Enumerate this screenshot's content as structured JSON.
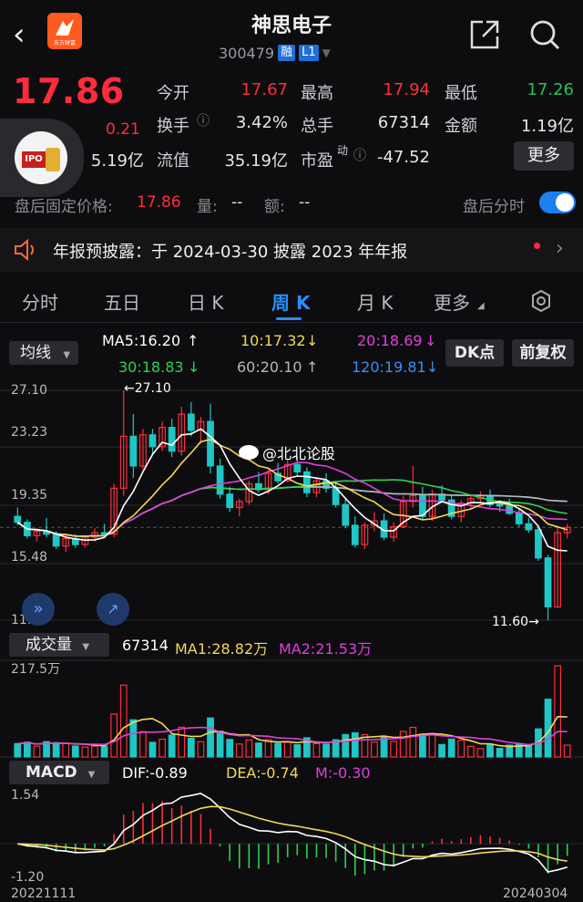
{
  "header": {
    "stock_name": "神思电子",
    "stock_code": "300479",
    "tag_margin": "融",
    "tag_level": "L1",
    "logo_brand": "东方财富"
  },
  "quote": {
    "price": "17.86",
    "change": "0.21",
    "rows": [
      {
        "l1": "今开",
        "v1": "17.67",
        "c1": "up",
        "l2": "最高",
        "v2": "17.94",
        "c2": "up",
        "l3": "最低",
        "v3": "17.26",
        "c3": "down"
      },
      {
        "l1": "换手",
        "v1": "3.42%",
        "c1": "white",
        "l2": "总手",
        "v2": "67314",
        "c2": "white",
        "l3": "金额",
        "v3": "1.19亿",
        "c3": "white"
      },
      {
        "l0v": "5.19亿",
        "l1": "流值",
        "v1": "35.19亿",
        "c1": "white",
        "l2": "市盈",
        "l2sup": "动",
        "v2": "-47.52",
        "c2": "white"
      }
    ],
    "more_label": "更多",
    "avatar_text": "IPO"
  },
  "after_hours": {
    "label": "盘后固定价格:",
    "price": "17.86",
    "vol_label": "量:",
    "vol": "--",
    "amt_label": "额:",
    "amt": "--",
    "toggle_label": "盘后分时"
  },
  "notice": {
    "text": "年报预披露：于 2024-03-30 披露 2023 年年报"
  },
  "tabs": [
    "分时",
    "五日",
    "日 K",
    "周 K",
    "月 K",
    "更多"
  ],
  "active_tab": "周 K",
  "toolbar": {
    "ma_select": "均线",
    "ma5": "MA5:16.20",
    "ma10": "10:17.32",
    "ma20": "20:18.69",
    "ma30": "30:18.83",
    "ma60": "60:20.10",
    "ma120": "120:19.81",
    "dk_label": "DK点",
    "fq_label": "前复权"
  },
  "kline": {
    "y_labels": [
      "27.10",
      "23.23",
      "19.35",
      "15.48",
      "11.60"
    ],
    "high_marker": "27.10",
    "low_marker": "11.60",
    "watermark": "@北北论股"
  },
  "volume": {
    "select": "成交量",
    "value": "67314",
    "ma1": "MA1:28.82万",
    "ma2": "MA2:21.53万",
    "y_top": "217.5万"
  },
  "macd": {
    "select": "MACD",
    "dif": "DIF:-0.89",
    "dea": "DEA:-0.74",
    "m": "M:-0.30",
    "y_top": "1.54",
    "y_bottom": "-1.20",
    "date_start": "20221111",
    "date_end": "20240304"
  },
  "colors": {
    "up": "#ff2d3b",
    "down": "#20c5c5",
    "ma5": "#ffffff",
    "ma10": "#f0d85a",
    "ma20": "#e040d8",
    "ma30": "#30d050",
    "ma60": "#b8b8b8",
    "ma120": "#3a8ff0",
    "accent": "#2b8cff"
  },
  "chart_data": {
    "type": "candlestick",
    "title": "",
    "y_range": [
      11.6,
      27.1
    ],
    "series": [
      {
        "values": [
          [
            18.6,
            19.2,
            18.0,
            18.2
          ],
          [
            18.2,
            18.4,
            17.1,
            17.3
          ],
          [
            17.3,
            17.8,
            16.9,
            17.6
          ],
          [
            17.6,
            18.5,
            17.2,
            17.4
          ],
          [
            17.4,
            17.6,
            16.4,
            16.6
          ],
          [
            16.6,
            17.3,
            16.2,
            17.1
          ],
          [
            17.1,
            17.4,
            16.5,
            16.7
          ],
          [
            16.7,
            17.3,
            16.5,
            17.2
          ],
          [
            17.2,
            17.8,
            16.9,
            17.5
          ],
          [
            17.5,
            18.1,
            17.2,
            17.4
          ],
          [
            17.4,
            20.8,
            17.2,
            20.5
          ],
          [
            20.5,
            27.1,
            20.0,
            24.0
          ],
          [
            24.0,
            25.5,
            21.2,
            22.0
          ],
          [
            22.0,
            24.5,
            21.8,
            24.1
          ],
          [
            24.1,
            24.5,
            22.8,
            23.3
          ],
          [
            23.3,
            25.0,
            23.0,
            24.6
          ],
          [
            24.6,
            25.2,
            22.6,
            23.0
          ],
          [
            23.0,
            26.0,
            22.7,
            25.5
          ],
          [
            25.5,
            26.3,
            24.0,
            24.4
          ],
          [
            24.4,
            25.3,
            23.5,
            25.0
          ],
          [
            25.0,
            26.2,
            21.5,
            22.0
          ],
          [
            22.0,
            22.5,
            19.8,
            20.1
          ],
          [
            20.1,
            20.6,
            18.9,
            19.2
          ],
          [
            19.2,
            19.8,
            18.6,
            19.6
          ],
          [
            19.6,
            21.0,
            19.4,
            20.8
          ],
          [
            20.8,
            21.6,
            20.2,
            20.4
          ],
          [
            20.4,
            21.8,
            20.1,
            21.5
          ],
          [
            21.5,
            22.2,
            20.8,
            21.0
          ],
          [
            21.0,
            22.4,
            20.9,
            22.1
          ],
          [
            22.1,
            22.6,
            21.3,
            21.6
          ],
          [
            21.6,
            21.9,
            19.9,
            20.2
          ],
          [
            20.2,
            21.2,
            19.9,
            21.0
          ],
          [
            21.0,
            21.5,
            20.2,
            20.5
          ],
          [
            20.5,
            20.9,
            19.2,
            19.4
          ],
          [
            19.4,
            19.9,
            17.8,
            18.0
          ],
          [
            18.0,
            18.6,
            16.5,
            16.7
          ],
          [
            16.7,
            18.2,
            16.4,
            18.0
          ],
          [
            18.0,
            18.9,
            17.6,
            18.3
          ],
          [
            18.3,
            18.8,
            17.0,
            17.2
          ],
          [
            17.2,
            18.2,
            16.9,
            17.9
          ],
          [
            17.9,
            20.0,
            17.8,
            19.6
          ],
          [
            19.6,
            22.0,
            19.2,
            20.0
          ],
          [
            20.0,
            20.6,
            18.4,
            18.6
          ],
          [
            18.6,
            20.4,
            18.3,
            20.1
          ],
          [
            20.1,
            20.7,
            19.5,
            19.7
          ],
          [
            19.7,
            20.1,
            18.4,
            18.6
          ],
          [
            18.6,
            19.7,
            18.2,
            19.5
          ],
          [
            19.5,
            20.1,
            19.1,
            19.8
          ],
          [
            19.8,
            20.3,
            19.5,
            20.0
          ],
          [
            20.0,
            20.4,
            19.2,
            19.4
          ],
          [
            19.4,
            19.7,
            18.9,
            19.3
          ],
          [
            19.3,
            19.8,
            18.7,
            18.8
          ],
          [
            18.8,
            19.1,
            17.9,
            18.1
          ],
          [
            18.1,
            18.5,
            17.5,
            17.7
          ],
          [
            17.7,
            18.0,
            15.6,
            15.8
          ],
          [
            15.8,
            16.0,
            11.6,
            12.5
          ],
          [
            12.5,
            17.9,
            12.4,
            17.5
          ],
          [
            17.5,
            18.1,
            17.1,
            17.86
          ]
        ]
      }
    ]
  }
}
